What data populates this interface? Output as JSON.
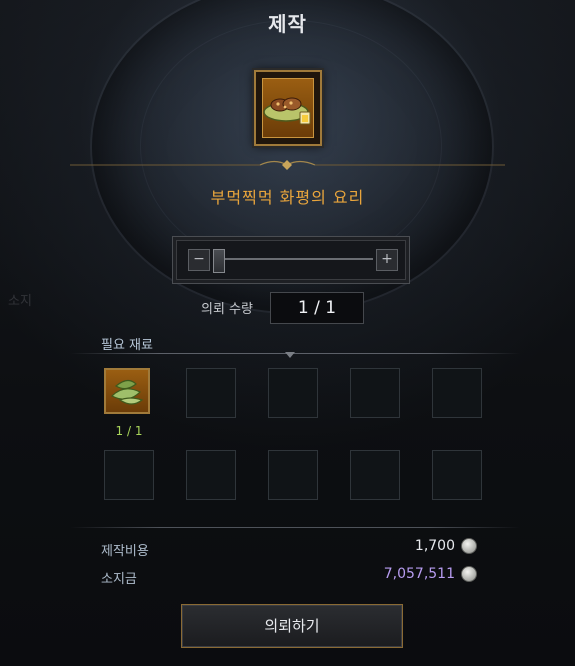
{
  "window": {
    "title": "제작"
  },
  "ghost_text": "소지",
  "item": {
    "name": "부먹찍먹 화평의 요리",
    "icon": "food-dish-icon"
  },
  "quantity": {
    "label": "의뢰 수량",
    "value": "1 / 1",
    "minus_symbol": "−",
    "plus_symbol": "+",
    "slider_fraction": 0.0
  },
  "materials": {
    "title": "필요 재료",
    "slots": [
      {
        "icon": "herb-leaves-icon",
        "count": "1 / 1",
        "filled": true
      },
      {
        "filled": false
      },
      {
        "filled": false
      },
      {
        "filled": false
      },
      {
        "filled": false
      },
      {
        "filled": false
      },
      {
        "filled": false
      },
      {
        "filled": false
      },
      {
        "filled": false
      },
      {
        "filled": false
      }
    ]
  },
  "costs": {
    "craft_cost_label": "제작비용",
    "craft_cost_value": "1,700",
    "owned_label": "소지금",
    "owned_value": "7,057,511",
    "currency_icon": "silver-coin-icon"
  },
  "request_button": {
    "label": "의뢰하기"
  },
  "colors": {
    "item_name": "#e9a53c",
    "owned_value": "#b79cf0",
    "count_ok": "#a8d45a",
    "gold_border": "#a07a3a"
  }
}
